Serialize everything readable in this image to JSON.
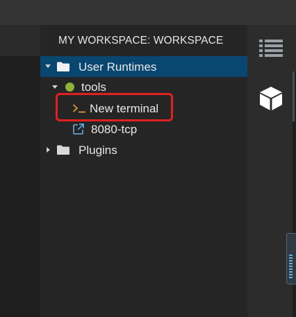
{
  "panel": {
    "title": "MY WORKSPACE: WORKSPACE"
  },
  "tree": {
    "user_runtimes": "User Runtimes",
    "tools": "tools",
    "new_terminal": "New terminal",
    "port": "8080-tcp",
    "plugins": "Plugins"
  },
  "colors": {
    "selection": "#094771",
    "running_status": "#8fb339",
    "terminal_icon": "#e8a13c",
    "link_icon": "#6cb5ea",
    "highlight_box": "#e32020"
  },
  "icons": {
    "right_bar": [
      "list-icon",
      "cube-icon"
    ]
  }
}
